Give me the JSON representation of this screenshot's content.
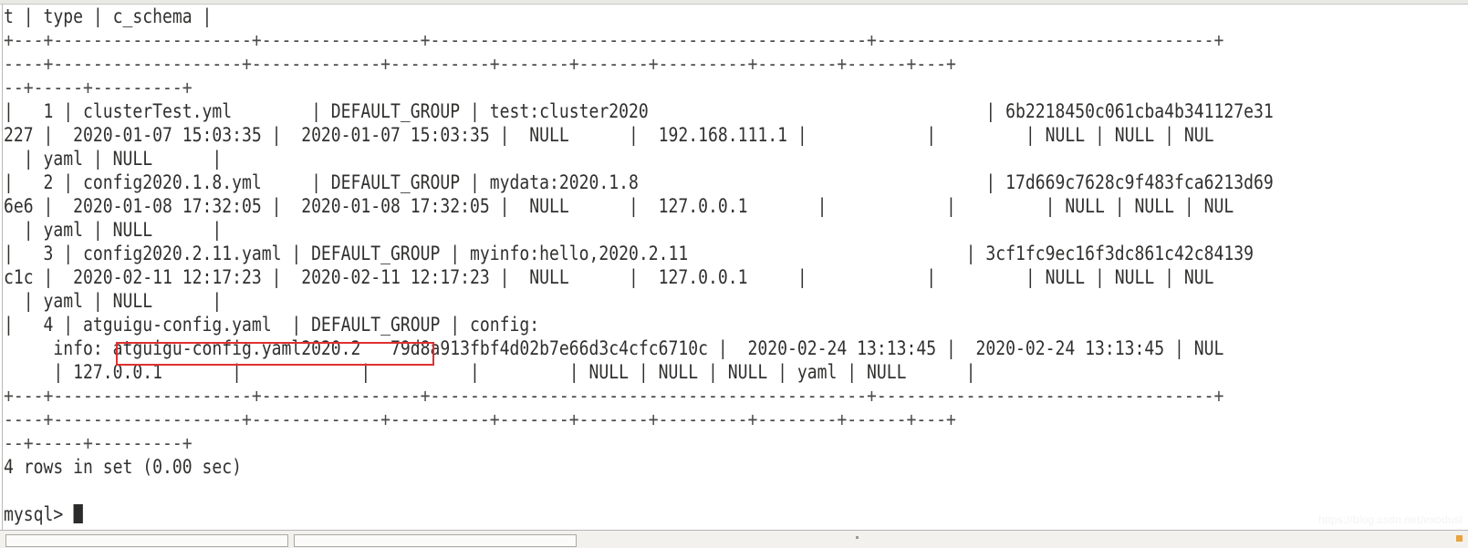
{
  "window": {
    "type": "terminal",
    "application": "mysql-client",
    "background_color": "#ffffff",
    "text_color": "#30302f"
  },
  "terminal": {
    "prompt": "mysql> ",
    "result_line": "4 rows in set (0.00 sec)",
    "lines": [
      "t | type | c_schema |",
      "+---+--------------------+----------------+--------------------------------------------+----------------------------------+",
      "----+-------------------+-------------+----------+-------+-------+---------+--------+------+---+",
      "--+-----+---------+",
      "|   1 | clusterTest.yml        | DEFAULT_GROUP | test:cluster2020                                  | 6b2218450c061cba4b341127e31",
      "227 |  2020-01-07 15:03:35 |  2020-01-07 15:03:35 |  NULL      |  192.168.111.1 |            |         | NULL | NULL | NUL",
      "  | yaml | NULL      |",
      "|   2 | config2020.1.8.yml     | DEFAULT_GROUP | mydata:2020.1.8                                   | 17d669c7628c9f483fca6213d69",
      "6e6 |  2020-01-08 17:32:05 |  2020-01-08 17:32:05 |  NULL      |  127.0.0.1       |            |         | NULL | NULL | NUL",
      "  | yaml | NULL      |",
      "|   3 | config2020.2.11.yaml | DEFAULT_GROUP | myinfo:hello,2020.2.11                            | 3cf1fc9ec16f3dc861c42c84139",
      "c1c |  2020-02-11 12:17:23 |  2020-02-11 12:17:23 |  NULL      |  127.0.0.1     |            |         | NULL | NULL | NUL",
      "  | yaml | NULL      |",
      "|   4 | atguigu-config.yaml  | DEFAULT_GROUP | config:",
      "     info: atguigu-config.yaml2020.2   79d8a913fbf4d02b7e66d3c4cfc6710c |  2020-02-24 13:13:45 |  2020-02-24 13:13:45 | NUL",
      "     | 127.0.0.1       |            |          |         | NULL | NULL | NULL | yaml | NULL      |",
      "+---+--------------------+----------------+--------------------------------------------+----------------------------------+",
      "----+-------------------+-------------+----------+-------+-------+---------+--------+------+---+",
      "--+-----+---------+",
      "4 rows in set (0.00 sec)",
      "",
      "mysql> "
    ]
  },
  "table": {
    "visible_headers": [
      "t",
      "type",
      "c_schema"
    ],
    "row_count": 4,
    "rows": [
      {
        "id": "1",
        "data_id": "clusterTest.yml",
        "group_id": "DEFAULT_GROUP",
        "content": "test:cluster2020",
        "md5": "6b2218450c061cba4b341127e31227",
        "gmt_create": "2020-01-07 15:03:35",
        "gmt_modified": "2020-01-07 15:03:35",
        "src_user": "NULL",
        "src_ip": "192.168.111.1",
        "app_name": "",
        "tenant_id": "",
        "c_desc": "NULL",
        "c_use": "NULL",
        "effect": "NULL",
        "type": "yaml",
        "c_schema": "NULL"
      },
      {
        "id": "2",
        "data_id": "config2020.1.8.yml",
        "group_id": "DEFAULT_GROUP",
        "content": "mydata:2020.1.8",
        "md5": "17d669c7628c9f483fca6213d696e6",
        "gmt_create": "2020-01-08 17:32:05",
        "gmt_modified": "2020-01-08 17:32:05",
        "src_user": "NULL",
        "src_ip": "127.0.0.1",
        "app_name": "",
        "tenant_id": "",
        "c_desc": "NULL",
        "c_use": "NULL",
        "effect": "NULL",
        "type": "yaml",
        "c_schema": "NULL"
      },
      {
        "id": "3",
        "data_id": "config2020.2.11.yaml",
        "group_id": "DEFAULT_GROUP",
        "content": "myinfo:hello,2020.2.11",
        "md5": "3cf1fc9ec16f3dc861c42c84139c1c",
        "gmt_create": "2020-02-11 12:17:23",
        "gmt_modified": "2020-02-11 12:17:23",
        "src_user": "NULL",
        "src_ip": "127.0.0.1",
        "app_name": "",
        "tenant_id": "",
        "c_desc": "NULL",
        "c_use": "NULL",
        "effect": "NULL",
        "type": "yaml",
        "c_schema": "NULL"
      },
      {
        "id": "4",
        "data_id": "atguigu-config.yaml",
        "group_id": "DEFAULT_GROUP",
        "content": "config:\n     info: atguigu-config.yaml2020.2",
        "md5": "79d8a913fbf4d02b7e66d3c4cfc6710c",
        "gmt_create": "2020-02-24 13:13:45",
        "gmt_modified": "2020-02-24 13:13:45",
        "src_user": "NULL",
        "src_ip": "127.0.0.1",
        "app_name": "",
        "tenant_id": "",
        "c_desc": "NULL",
        "c_use": "NULL",
        "effect": "NULL",
        "type": "yaml",
        "c_schema": "NULL"
      }
    ]
  },
  "annotation": {
    "type": "rectangle-highlight",
    "color": "#e03030",
    "target_text": "atguigu-config.yaml2020.2"
  },
  "watermark": {
    "text": "https://blog.csdn.net/exodusl"
  },
  "taskbar": {
    "visible": true,
    "items": [
      "",
      ""
    ]
  }
}
